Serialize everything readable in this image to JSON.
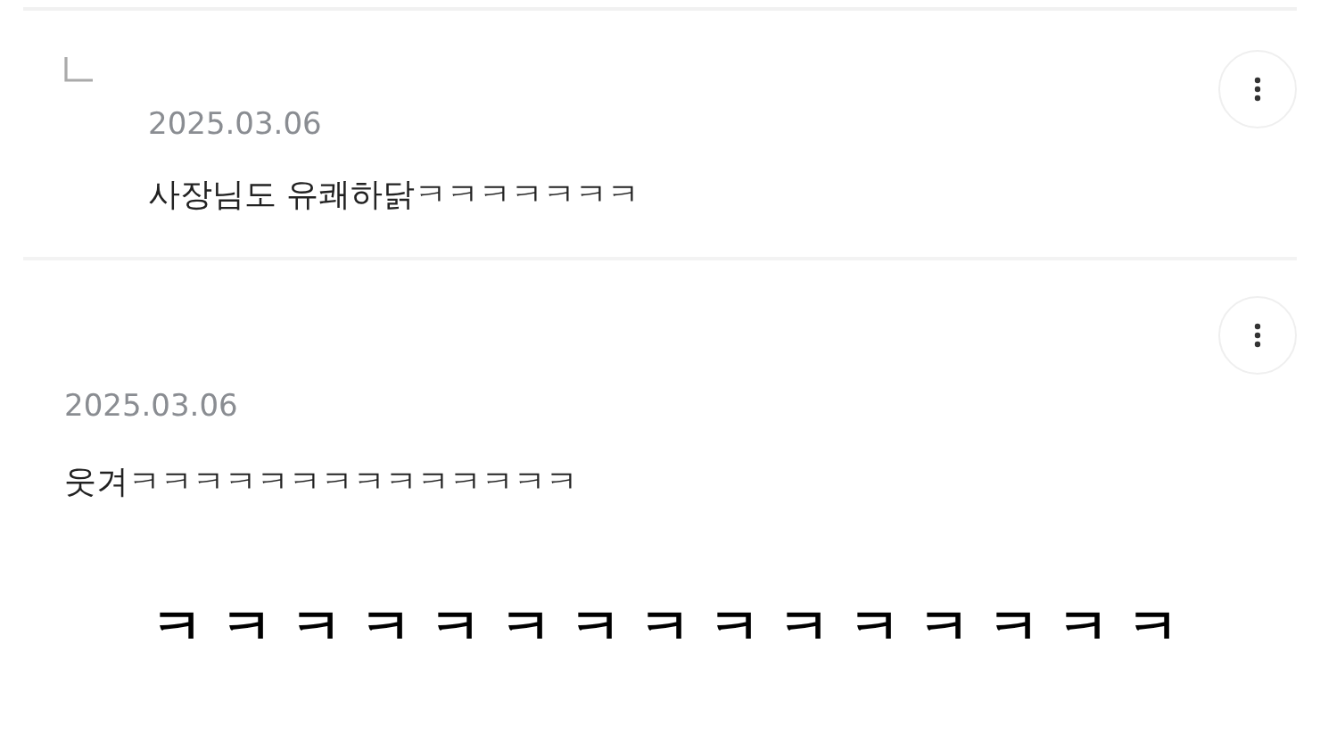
{
  "comments": [
    {
      "kind": "reply",
      "date": "2025.03.06",
      "text": "사장님도 유쾌하닭ㅋㅋㅋㅋㅋㅋㅋ"
    },
    {
      "kind": "comment",
      "date": "2025.03.06",
      "text": "웃겨ㅋㅋㅋㅋㅋㅋㅋㅋㅋㅋㅋㅋㅋㅋ"
    }
  ],
  "caption": "ㅋ ㅋ ㅋ ㅋ ㅋ ㅋ ㅋ ㅋ ㅋ ㅋ ㅋ ㅋ ㅋ ㅋ ㅋ"
}
